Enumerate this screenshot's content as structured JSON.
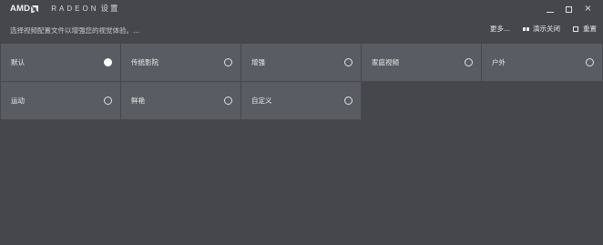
{
  "title_bar": {
    "brand": "AMD",
    "product": "RADEON",
    "app": "设置",
    "minimize_label": "minimize",
    "maximize_label": "maximize",
    "close_label": "close"
  },
  "subheader": {
    "hint": "选择视频配置文件以增强您的视觉体验。...",
    "more_label": "更多...",
    "demo_label": "演示关闭",
    "reset_label": "重置"
  },
  "profiles": [
    {
      "label": "默认",
      "selected": true
    },
    {
      "label": "传统影院",
      "selected": false
    },
    {
      "label": "增强",
      "selected": false
    },
    {
      "label": "家庭视频",
      "selected": false
    },
    {
      "label": "户外",
      "selected": false
    },
    {
      "label": "运动",
      "selected": false
    },
    {
      "label": "鲜艳",
      "selected": false
    },
    {
      "label": "自定义",
      "selected": false
    }
  ],
  "icons": {
    "brand_arrow": "amd-arrow-icon",
    "minimize": "minimize-icon",
    "maximize": "maximize-icon",
    "close": "close-icon",
    "demo": "demo-split-icon",
    "reset": "reset-icon",
    "radio": "radio-icon"
  },
  "colors": {
    "background": "#45474d",
    "tile": "#5a5c63",
    "text": "#ececec",
    "selected_radio": "#ffffff"
  }
}
